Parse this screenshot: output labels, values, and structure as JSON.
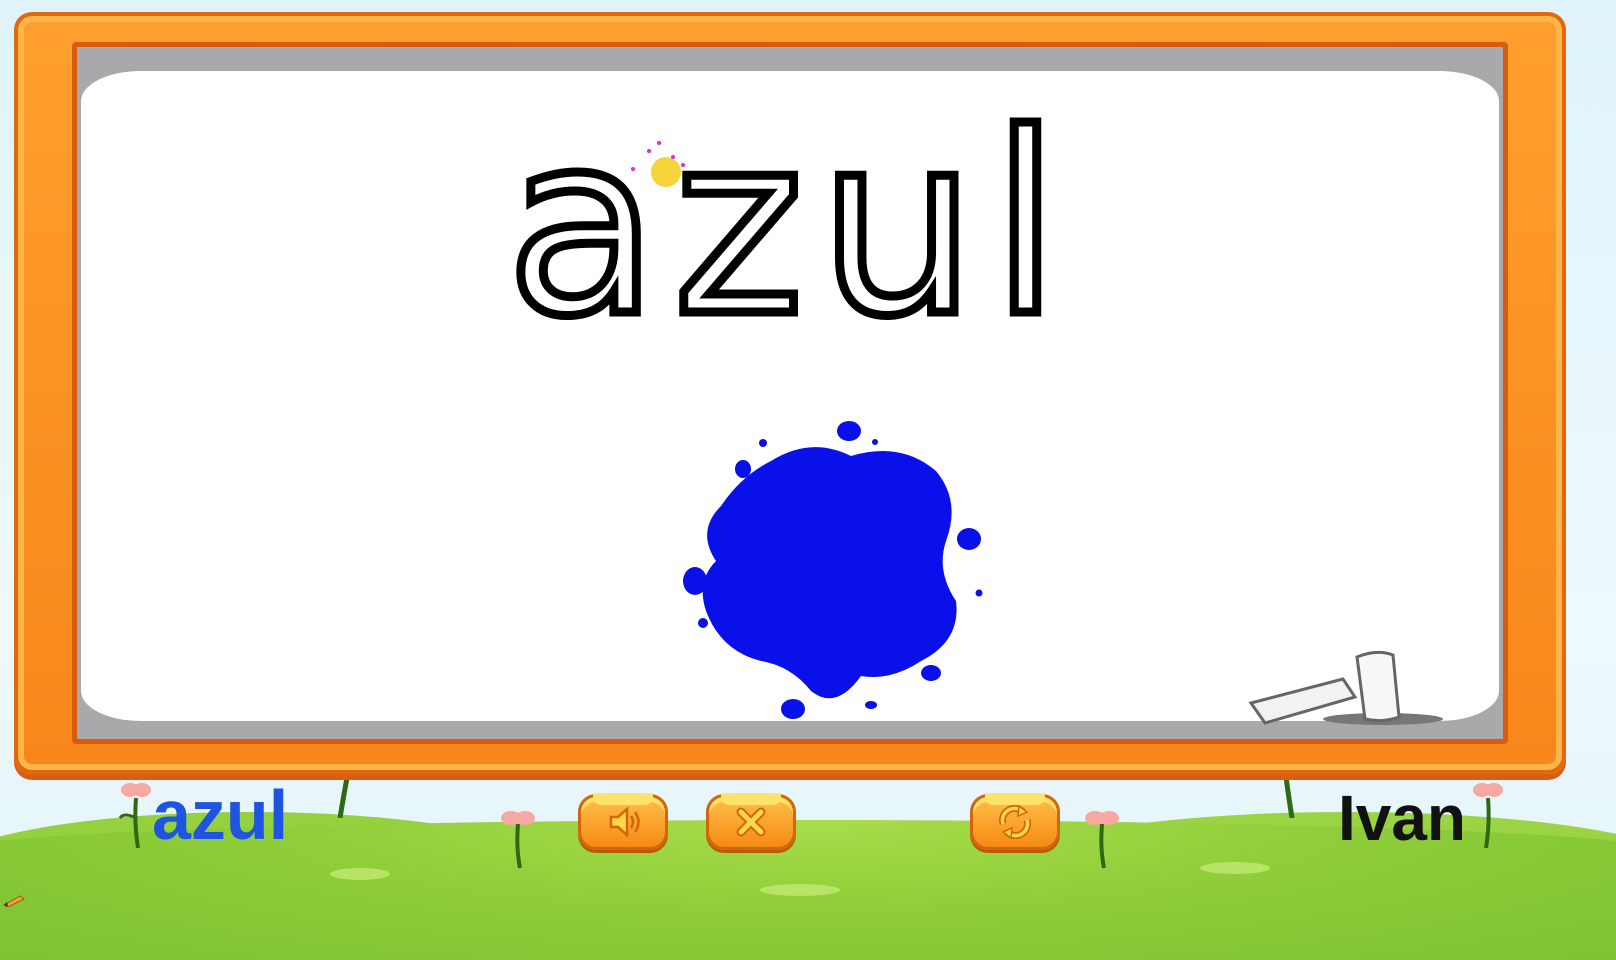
{
  "lesson": {
    "word": "azul",
    "caption_word": "azul",
    "student_name": "Ivan"
  },
  "colors": {
    "board_orange": "#f7861b",
    "paint_blue": "#0a10ea",
    "caption_blue": "#1f54e0",
    "tracer_yellow": "#f7d43c"
  },
  "controls": {
    "sound_icon": "speaker-icon",
    "close_icon": "close-icon",
    "repeat_icon": "repeat-icon"
  }
}
